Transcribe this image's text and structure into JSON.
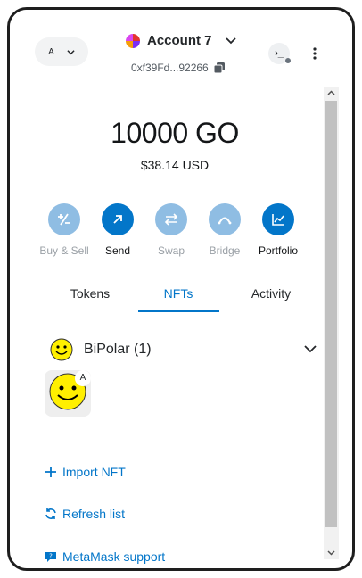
{
  "header": {
    "network_initial": "A",
    "account_name": "Account 7",
    "address": "0xf39Fd...92266",
    "snap_glyph": "›_"
  },
  "balance": {
    "primary": "10000 GO",
    "fiat": "$38.14 USD"
  },
  "actions": [
    {
      "label": "Buy & Sell",
      "icon": "plus-minus-icon",
      "enabled": false
    },
    {
      "label": "Send",
      "icon": "arrow-up-right-icon",
      "enabled": true
    },
    {
      "label": "Swap",
      "icon": "swap-arrows-icon",
      "enabled": false
    },
    {
      "label": "Bridge",
      "icon": "bridge-icon",
      "enabled": false
    },
    {
      "label": "Portfolio",
      "icon": "chart-icon",
      "enabled": true
    }
  ],
  "tabs": [
    {
      "label": "Tokens",
      "active": false
    },
    {
      "label": "NFTs",
      "active": true
    },
    {
      "label": "Activity",
      "active": false
    }
  ],
  "nfts": {
    "collection_name": "BiPolar (1)",
    "tile_badge": "A"
  },
  "links": {
    "import_nft": "Import NFT",
    "refresh_list": "Refresh list",
    "support": "MetaMask support"
  },
  "colors": {
    "primary": "#0376c9",
    "primary_disabled": "#8fbde3",
    "text": "#24272a"
  }
}
